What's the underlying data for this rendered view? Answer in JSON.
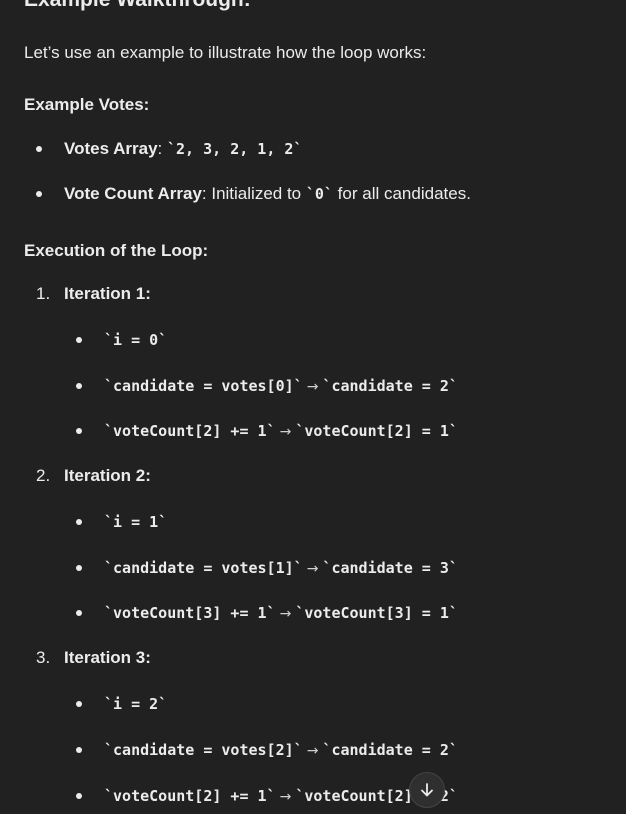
{
  "section": {
    "title": "Example Walkthrough:",
    "intro": "Let’s use an example to illustrate how the loop works:"
  },
  "example_votes": {
    "heading": "Example Votes:",
    "items": [
      {
        "label": "Votes Array",
        "sep": ": ",
        "code": "`2, 3, 2, 1, 2`",
        "tail": ""
      },
      {
        "label": "Vote Count Array",
        "sep": ": Initialized to ",
        "code": "`0`",
        "tail": " for all candidates."
      }
    ]
  },
  "execution": {
    "heading": "Execution of the Loop:",
    "iterations": [
      {
        "num": "1.",
        "title": "Iteration 1:",
        "steps": [
          {
            "code": "`i = 0`"
          },
          {
            "code": "`candidate = votes[0]`",
            "arrow": "→",
            "result": "`candidate = 2`"
          },
          {
            "code": "`voteCount[2] += 1`",
            "arrow": "→",
            "result": "`voteCount[2] = 1`"
          }
        ]
      },
      {
        "num": "2.",
        "title": "Iteration 2:",
        "steps": [
          {
            "code": "`i = 1`"
          },
          {
            "code": "`candidate = votes[1]`",
            "arrow": "→",
            "result": "`candidate = 3`"
          },
          {
            "code": "`voteCount[3] += 1`",
            "arrow": "→",
            "result": "`voteCount[3] = 1`"
          }
        ]
      },
      {
        "num": "3.",
        "title": "Iteration 3:",
        "steps": [
          {
            "code": "`i = 2`"
          },
          {
            "code": "`candidate = votes[2]`",
            "arrow": "→",
            "result": "`candidate = 2`"
          },
          {
            "code": "`voteCount[2] += 1`",
            "arrow": "→",
            "result": "`voteCount[2] = 2`"
          }
        ]
      }
    ]
  },
  "icons": {
    "scroll_down": "arrow-down-icon"
  }
}
